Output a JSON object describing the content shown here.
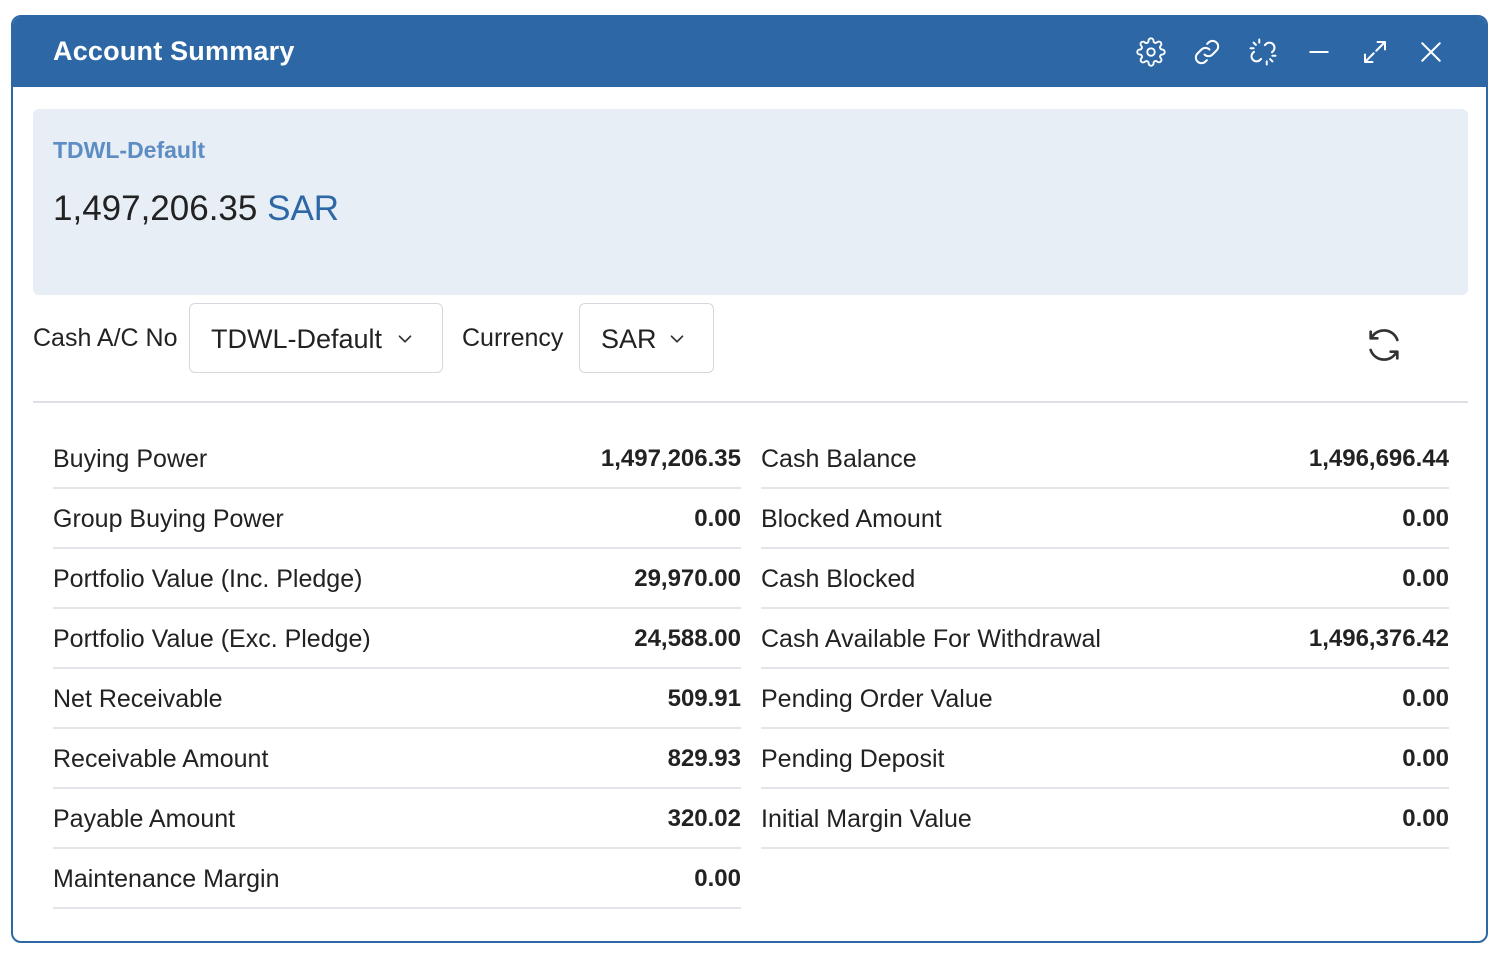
{
  "window": {
    "title": "Account Summary",
    "controls": [
      {
        "name": "settings-icon"
      },
      {
        "name": "link-icon"
      },
      {
        "name": "unlink-icon"
      },
      {
        "name": "minimize-icon"
      },
      {
        "name": "maximize-icon"
      },
      {
        "name": "close-icon"
      }
    ]
  },
  "colors": {
    "header": "#2d67a6",
    "summary_bg": "#e7eef6",
    "account_label": "#5d8dc3"
  },
  "summary": {
    "account": "TDWL-Default",
    "amount": "1,497,206.35",
    "currency": "SAR"
  },
  "filters": {
    "cash_ac_label": "Cash A/C No",
    "cash_ac_value": "TDWL-Default",
    "currency_label": "Currency",
    "currency_value": "SAR",
    "refresh_icon": "refresh-icon"
  },
  "left_rows": [
    {
      "label": "Buying Power",
      "value": "1,497,206.35"
    },
    {
      "label": "Group Buying Power",
      "value": "0.00"
    },
    {
      "label": "Portfolio Value (Inc. Pledge)",
      "value": "29,970.00"
    },
    {
      "label": "Portfolio Value (Exc. Pledge)",
      "value": "24,588.00"
    },
    {
      "label": "Net Receivable",
      "value": "509.91"
    },
    {
      "label": "Receivable Amount",
      "value": "829.93"
    },
    {
      "label": "Payable Amount",
      "value": "320.02"
    },
    {
      "label": "Maintenance Margin",
      "value": "0.00"
    }
  ],
  "right_rows": [
    {
      "label": "Cash Balance",
      "value": "1,496,696.44"
    },
    {
      "label": "Blocked Amount",
      "value": "0.00"
    },
    {
      "label": "Cash Blocked",
      "value": "0.00"
    },
    {
      "label": "Cash Available For Withdrawal",
      "value": "1,496,376.42"
    },
    {
      "label": "Pending Order Value",
      "value": "0.00"
    },
    {
      "label": "Pending Deposit",
      "value": "0.00"
    },
    {
      "label": "Initial Margin Value",
      "value": "0.00"
    }
  ]
}
